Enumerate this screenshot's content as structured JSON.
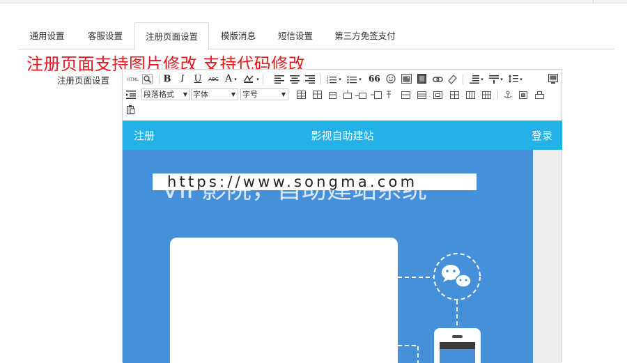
{
  "tabs": [
    {
      "label": "通用设置",
      "active": false
    },
    {
      "label": "客服设置",
      "active": false
    },
    {
      "label": "注册页面设置",
      "active": true
    },
    {
      "label": "模版消息",
      "active": false
    },
    {
      "label": "短信设置",
      "active": false
    },
    {
      "label": "第三方免签支付",
      "active": false
    }
  ],
  "overlay_text": "注册页面支持图片修改  支持代码修改",
  "field_label": "注册页面设置",
  "toolbar": {
    "html_label": "HTML",
    "bold": "B",
    "italic": "I",
    "underline": "U",
    "strikethrough": "ABC",
    "font_color": "A",
    "quote": "66",
    "paragraph_format": "段落格式",
    "font_family": "字体",
    "font_size": "字号"
  },
  "preview": {
    "app_bar": {
      "left": "注册",
      "title": "影视自助建站",
      "right": "登录"
    },
    "headline": "VIP影院，自助建站系统",
    "watermark": "https://www.songma.com",
    "colors": {
      "app_bar": "#24b1e8",
      "banner": "#4590d8"
    }
  }
}
